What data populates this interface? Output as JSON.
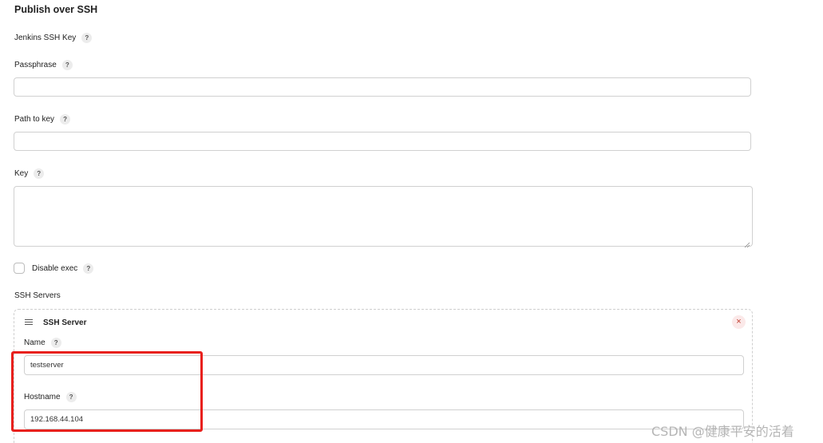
{
  "section": {
    "title": "Publish over SSH"
  },
  "fields": {
    "jenkins_ssh_key": {
      "label": "Jenkins SSH Key"
    },
    "passphrase": {
      "label": "Passphrase",
      "value": ""
    },
    "path_to_key": {
      "label": "Path to key",
      "value": ""
    },
    "key": {
      "label": "Key",
      "value": ""
    },
    "disable_exec": {
      "label": "Disable exec",
      "checked": false
    }
  },
  "help_glyph": "?",
  "ssh_servers": {
    "label": "SSH Servers",
    "server": {
      "title": "SSH Server",
      "close_glyph": "×",
      "name": {
        "label": "Name",
        "value": "testserver"
      },
      "hostname": {
        "label": "Hostname",
        "value": "192.168.44.104"
      }
    }
  },
  "watermark": "CSDN @健康平安的活着",
  "colors": {
    "highlight": "#e8201c",
    "close": "#c0392b"
  },
  "icons": [
    "question-mark-icon",
    "drag-handle-icon",
    "close-icon",
    "resize-grip-icon"
  ]
}
